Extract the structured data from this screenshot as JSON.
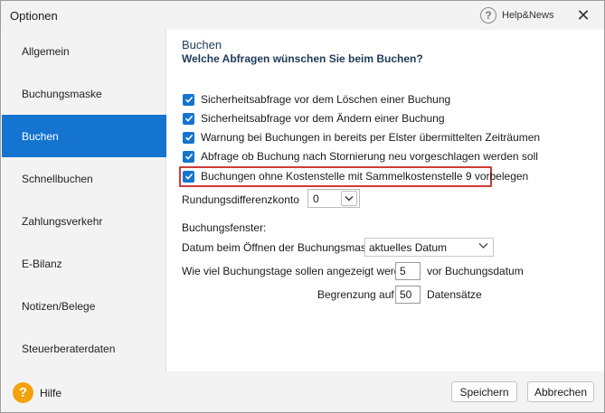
{
  "window": {
    "title": "Optionen",
    "help_news_label": "Help&News",
    "close_glyph": "✕"
  },
  "sidebar": {
    "items": [
      {
        "label": "Allgemein"
      },
      {
        "label": "Buchungsmaske"
      },
      {
        "label": "Buchen",
        "active": true
      },
      {
        "label": "Schnellbuchen"
      },
      {
        "label": "Zahlungsverkehr"
      },
      {
        "label": "E-Bilanz"
      },
      {
        "label": "Notizen/Belege"
      },
      {
        "label": "Steuerberaterdaten"
      }
    ]
  },
  "main": {
    "title": "Buchen",
    "subtitle": "Welche Abfragen wünschen Sie beim Buchen?",
    "checkboxes": [
      {
        "label": "Sicherheitsabfrage vor dem Löschen einer Buchung",
        "checked": true
      },
      {
        "label": "Sicherheitsabfrage vor dem Ändern einer Buchung",
        "checked": true
      },
      {
        "label": "Warnung bei Buchungen in bereits per Elster übermittelten Zeiträumen",
        "checked": true
      },
      {
        "label": "Abfrage ob Buchung nach Stornierung neu vorgeschlagen werden soll",
        "checked": true
      },
      {
        "label": "Buchungen ohne Kostenstelle mit Sammelkostenstelle 9 vorbelegen",
        "checked": true,
        "highlighted": true
      }
    ],
    "rundung_label": "Rundungsdifferenzkonto",
    "rundung_value": "0",
    "buchungsfenster_label": "Buchungsfenster:",
    "datum_label": "Datum beim Öffnen der Buchungsmaske",
    "datum_value": "aktuelles Datum",
    "tage_label": "Wie viel Buchungstage sollen angezeigt werden",
    "tage_value": "5",
    "tage_suffix": "vor Buchungsdatum",
    "begrenzung_label": "Begrenzung auf",
    "begrenzung_value": "50",
    "begrenzung_suffix": "Datensätze"
  },
  "footer": {
    "help_label": "Hilfe",
    "help_glyph": "?",
    "save_label": "Speichern",
    "cancel_label": "Abbrechen"
  },
  "colors": {
    "accent": "#1474cf",
    "highlight_border": "#d03a3a",
    "help_orange": "#f2a20c"
  },
  "icons": [
    "help-icon",
    "close-icon",
    "check-icon",
    "chevron-down-icon",
    "help-orange-icon"
  ]
}
